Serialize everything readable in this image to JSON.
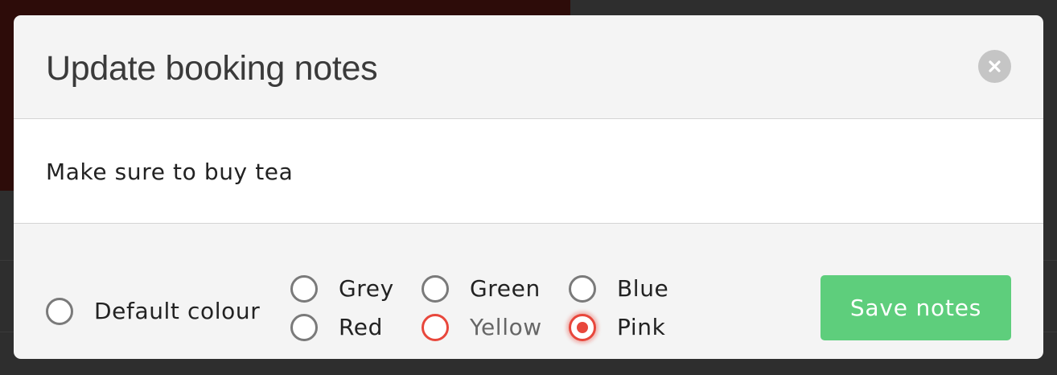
{
  "modal": {
    "title": "Update booking notes",
    "notes_text": "Make sure to buy tea"
  },
  "colour_options": {
    "default": "Default colour",
    "grey": "Grey",
    "green": "Green",
    "blue": "Blue",
    "red": "Red",
    "yellow": "Yellow",
    "pink": "Pink",
    "selected": "Pink"
  },
  "footer": {
    "save_label": "Save notes"
  },
  "colors": {
    "accent_red": "#e8473c",
    "save_green": "#5ece7c",
    "backdrop": "#2e2e2e",
    "backdrop_red": "#2d0c09"
  },
  "icons": {
    "close": "close-icon"
  }
}
